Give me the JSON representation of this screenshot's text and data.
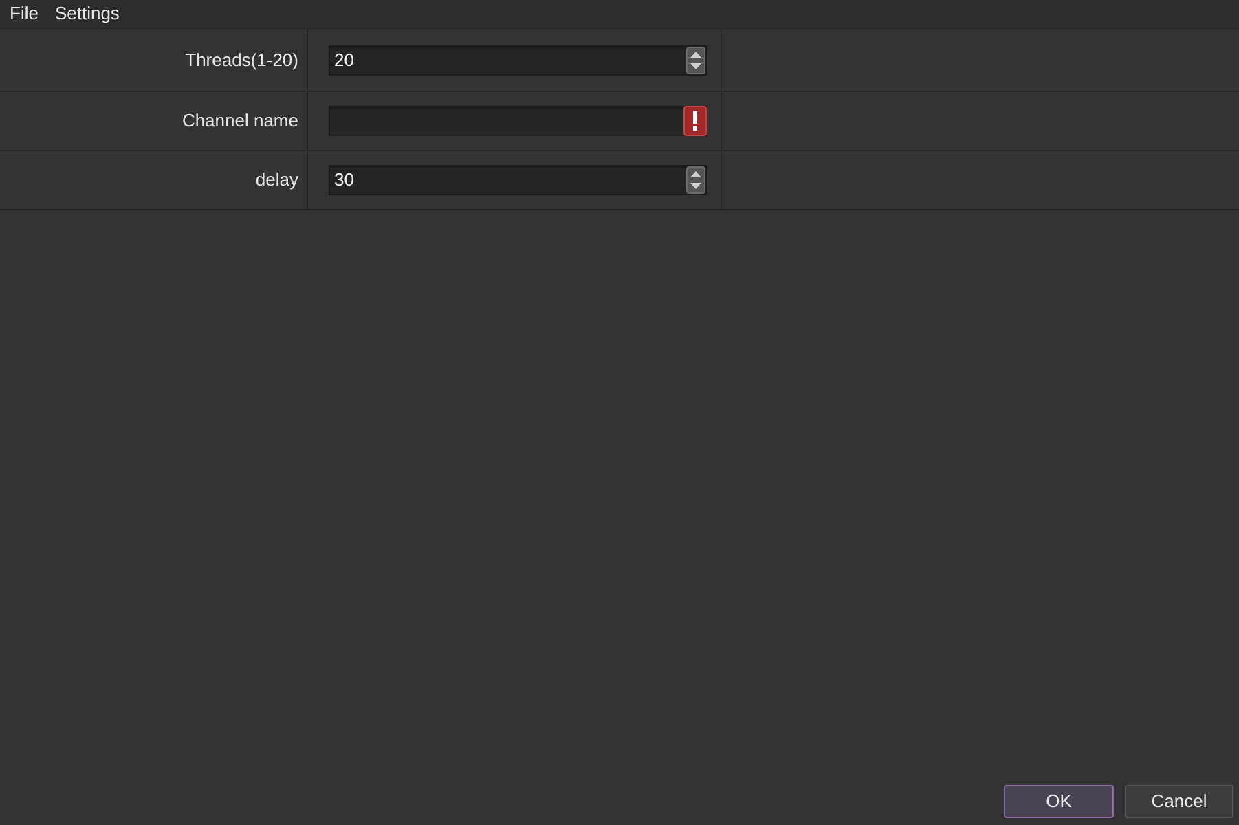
{
  "menu_bar": {
    "items": [
      "File",
      "Settings"
    ]
  },
  "form": {
    "rows": [
      {
        "label": "Threads(1-20)",
        "kind": "spinbox",
        "value": "20",
        "invalid": false
      },
      {
        "label": "Channel name",
        "kind": "text",
        "invalid": true
      },
      {
        "label": "delay",
        "kind": "spinbox",
        "value": "30",
        "invalid": false
      }
    ]
  },
  "buttons": [
    {
      "label": "OK",
      "default": true
    },
    {
      "label": "Cancel",
      "default": false
    }
  ]
}
